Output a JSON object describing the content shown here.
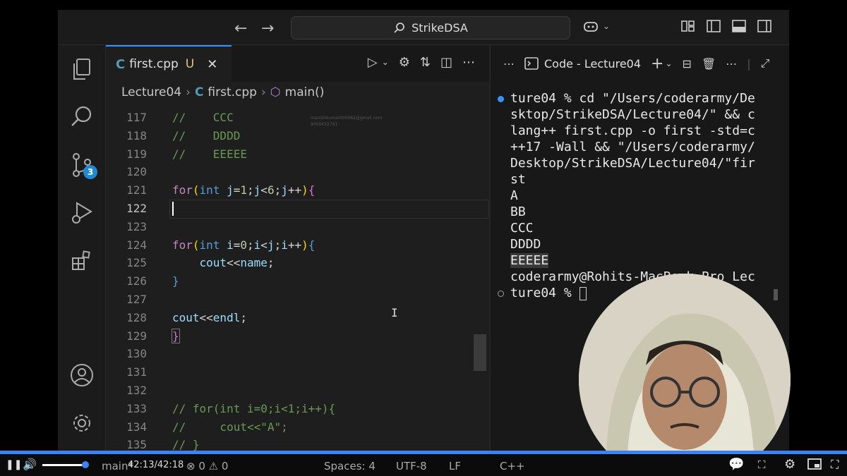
{
  "window": {
    "search_label": "StrikeDSA"
  },
  "editor": {
    "tab": {
      "icon": "C",
      "filename": "first.cpp",
      "status": "U"
    },
    "breadcrumb": {
      "folder": "Lecture04",
      "file": "first.cpp",
      "symbol": "main()"
    },
    "lines": [
      {
        "n": "117"
      },
      {
        "n": "118"
      },
      {
        "n": "119"
      },
      {
        "n": "120"
      },
      {
        "n": "121"
      },
      {
        "n": "122"
      },
      {
        "n": "123"
      },
      {
        "n": "124"
      },
      {
        "n": "125"
      },
      {
        "n": "126"
      },
      {
        "n": "127"
      },
      {
        "n": "128"
      },
      {
        "n": "129"
      },
      {
        "n": "130"
      },
      {
        "n": "131"
      },
      {
        "n": "132"
      },
      {
        "n": "133"
      },
      {
        "n": "134"
      },
      {
        "n": "135"
      }
    ]
  },
  "activity": {
    "scm_badge": "3"
  },
  "terminal": {
    "title": "Code - Lecture04",
    "output": [
      "ture04 % cd \"/Users/coderarmy/De",
      "sktop/StrikeDSA/Lecture04/\" && c",
      "lang++ first.cpp -o first -std=c",
      "++17 -Wall && \"/Users/coderarmy/",
      "Desktop/StrikeDSA/Lecture04/\"fir",
      "st",
      "A",
      "BB",
      "CCC",
      "DDDD",
      "EEEEE",
      "coderarmy@Rohits-MacBook-Pro Lec",
      "ture04 % "
    ]
  },
  "statusbar": {
    "branch": "main*",
    "problems": "⊗ 0 ⚠ 0",
    "spaces": "Spaces: 4",
    "encoding": "UTF-8",
    "eol": "LF",
    "language": "C++"
  },
  "player": {
    "time": "42:13/42:18"
  },
  "colors": {
    "accent": "#3794ff",
    "progress": "#3b82f6"
  }
}
